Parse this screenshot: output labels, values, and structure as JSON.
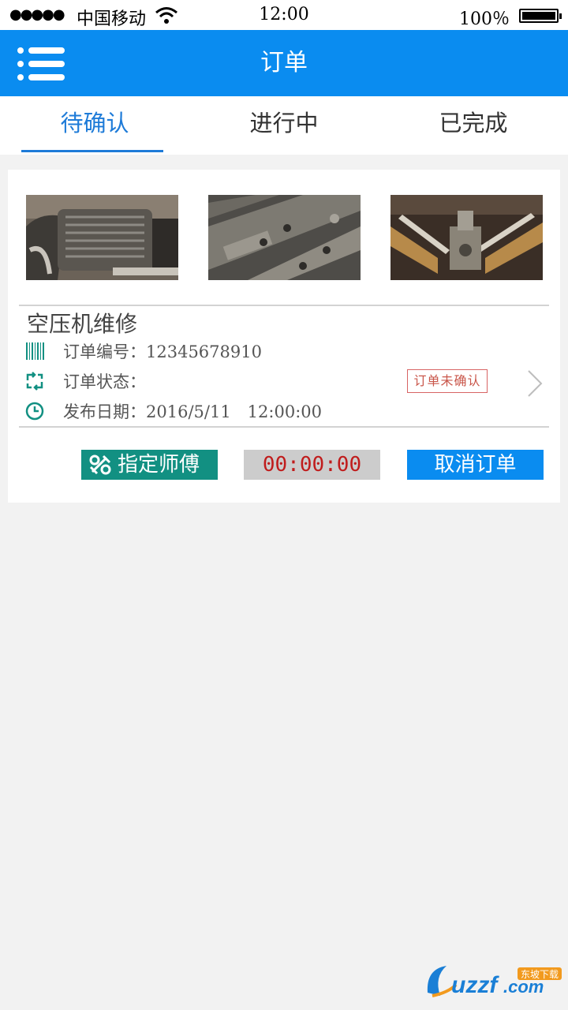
{
  "status_bar": {
    "signal": "●●●●●",
    "carrier": "中国移动",
    "time": "12:00",
    "battery": "100％"
  },
  "header": {
    "title": "订单"
  },
  "tabs": [
    {
      "label": "待确认",
      "active": true
    },
    {
      "label": "进行中",
      "active": false
    },
    {
      "label": "已完成",
      "active": false
    }
  ],
  "order": {
    "title": "空压机维修",
    "number_label": "订单编号：12345678910",
    "status_label": "订单状态：",
    "status_stamp": "订单未确认",
    "date_label": "发布日期：2016/5/11　12:00:00",
    "images": [
      "engine-photo",
      "machine-rails-photo",
      "machine-mechanism-photo"
    ]
  },
  "actions": {
    "assign_label": "指定师傅",
    "timer": "00:00:00",
    "cancel_label": "取消订单"
  },
  "watermark": {
    "brand": "uzzf.com",
    "badge": "东坡下载"
  },
  "colors": {
    "primary": "#0a8cf0",
    "teal": "#129082",
    "tab_active": "#1e7bd8",
    "timer_text": "#c01c1c"
  }
}
